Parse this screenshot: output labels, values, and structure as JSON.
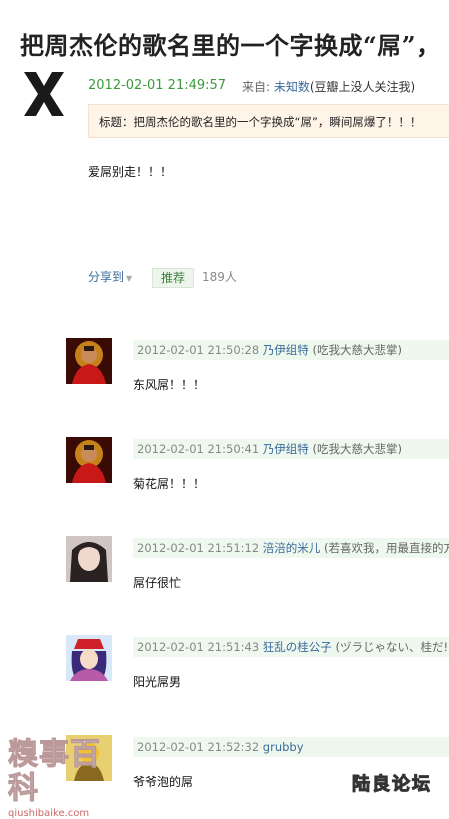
{
  "post": {
    "title": "把周杰伦的歌名里的一个字换成“屌”，",
    "time": "2012-02-01 21:49:57",
    "from_label": "来自: ",
    "from_source": "未知数",
    "from_group": "(豆瓣上没人关注我)",
    "quote": "标题：把周杰伦的歌名里的一个字换成“屌”，瞬间屌爆了！！！",
    "body": "爱屌别走！！！",
    "share_label": "分享到",
    "recommend_label": "推荐",
    "recommend_count": "189人"
  },
  "comments": [
    {
      "time": "2012-02-01 21:50:28",
      "name": "乃伊组特",
      "sig": "(吃我大慈大悲掌)",
      "text": "东风屌！！！",
      "avatar": "red-buddha"
    },
    {
      "time": "2012-02-01 21:50:41",
      "name": "乃伊组特",
      "sig": "(吃我大慈大悲掌)",
      "text": "菊花屌！！！",
      "avatar": "red-buddha"
    },
    {
      "time": "2012-02-01 21:51:12",
      "name": "涪涪的米儿",
      "sig": "(若喜欢我，用最直接的方",
      "text": "屌仔很忙",
      "avatar": "girl-photo"
    },
    {
      "time": "2012-02-01 21:51:43",
      "name": "狂乱の桂公子",
      "sig": "(ヅラじゃない、桂だ!)",
      "text": "阳光屌男",
      "avatar": "anime-boy"
    },
    {
      "time": "2012-02-01 21:52:32",
      "name": "grubby",
      "sig": "",
      "text": "爷爷泡的屌",
      "avatar": "yellow-figure"
    }
  ],
  "watermarks": {
    "left_big": "糗事百科",
    "left_small": "qiushibaike.com",
    "right": "陆良论坛"
  }
}
